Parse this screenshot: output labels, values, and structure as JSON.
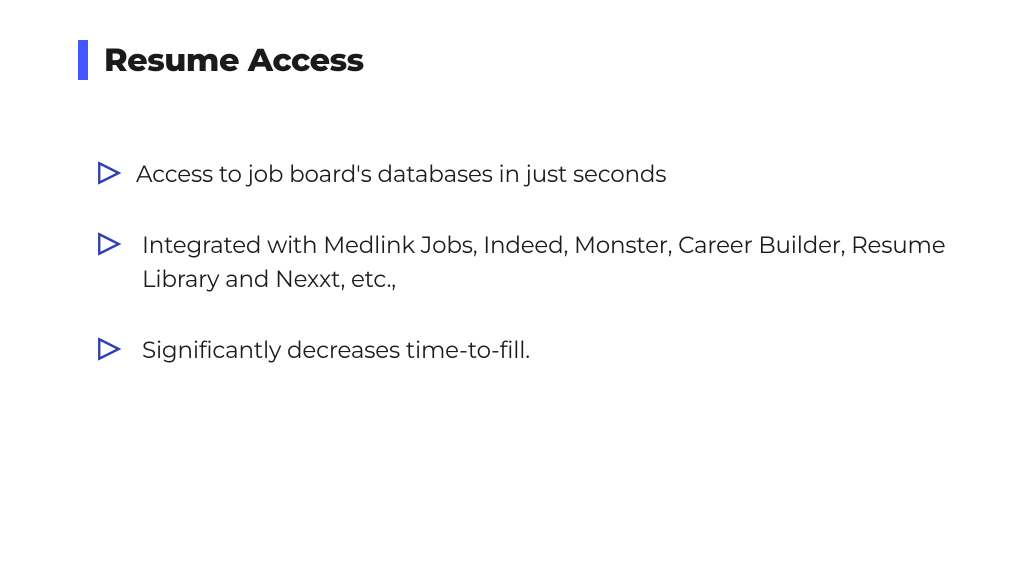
{
  "header": {
    "title": "Resume Access",
    "accent_color": "#4356ff"
  },
  "bullets": [
    {
      "text": "Access to job board's databases in just seconds"
    },
    {
      "text": "Integrated with Medlink Jobs, Indeed, Monster, Career Builder, Resume Library and Nexxt, etc.,"
    },
    {
      "text": "Significantly decreases time-to-fill."
    }
  ],
  "icon_stroke": "#2c3fb8"
}
